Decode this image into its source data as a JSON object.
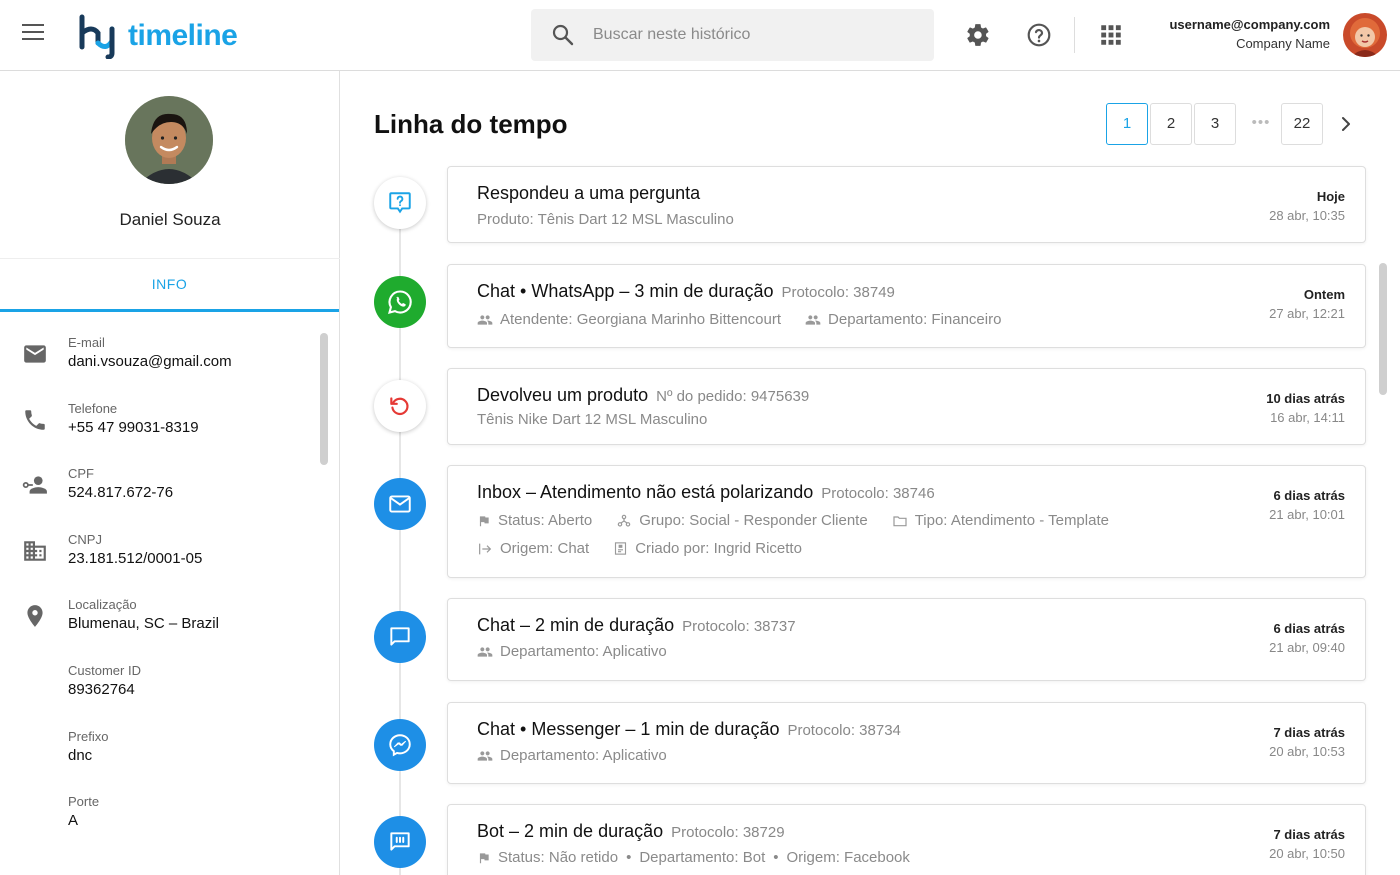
{
  "app": {
    "logo_text": "timeline"
  },
  "search": {
    "placeholder": "Buscar neste histórico"
  },
  "user": {
    "email": "username@company.com",
    "company": "Company Name"
  },
  "profile": {
    "name": "Daniel Souza",
    "tab_info": "INFO",
    "fields": [
      {
        "label": "E-mail",
        "value": "dani.vsouza@gmail.com",
        "icon": "email-icon"
      },
      {
        "label": "Telefone",
        "value": "+55 47 99031-8319",
        "icon": "phone-icon"
      },
      {
        "label": "CPF",
        "value": "524.817.672-76",
        "icon": "person-key-icon"
      },
      {
        "label": "CNPJ",
        "value": "23.181.512/0001-05",
        "icon": "building-icon"
      },
      {
        "label": "Localização",
        "value": "Blumenau, SC – Brazil",
        "icon": "location-icon"
      },
      {
        "label": "Customer ID",
        "value": "89362764"
      },
      {
        "label": "Prefixo",
        "value": "dnc"
      },
      {
        "label": "Porte",
        "value": "A"
      }
    ]
  },
  "main": {
    "title": "Linha do tempo",
    "pagination": {
      "pages": [
        "1",
        "2",
        "3"
      ],
      "last": "22",
      "current": "1"
    },
    "events": [
      {
        "title": "Respondeu a uma pergunta",
        "subtitle": "Produto: Tênis Dart 12 MSL Masculino",
        "when_relative": "Hoje",
        "when_absolute": "28 abr, 10:35",
        "icon": "question-chat-icon"
      },
      {
        "title": "Chat  •  WhatsApp – 3 min de duração",
        "protocol": "Protocolo: 38749",
        "meta": [
          "Atendente: Georgiana Marinho Bittencourt",
          "Departamento: Financeiro"
        ],
        "when_relative": "Ontem",
        "when_absolute": "27 abr, 12:21",
        "icon": "whatsapp-icon"
      },
      {
        "title": "Devolveu um produto",
        "protocol": "Nº do pedido: 9475639",
        "subtitle": "Tênis Nike Dart 12 MSL Masculino",
        "when_relative": "10 dias atrás",
        "when_absolute": "16 abr, 14:11",
        "icon": "return-icon"
      },
      {
        "title": "Inbox – Atendimento não está polarizando",
        "protocol": "Protocolo: 38746",
        "meta": [
          "Status: Aberto",
          "Grupo:  Social - Responder Cliente",
          "Tipo:  Atendimento - Template"
        ],
        "meta2": [
          "Origem: Chat",
          "Criado por: Ingrid Ricetto"
        ],
        "when_relative": "6 dias atrás",
        "when_absolute": "21 abr, 10:01",
        "icon": "mail-icon"
      },
      {
        "title": "Chat – 2 min de duração",
        "protocol": "Protocolo: 38737",
        "meta": [
          "Departamento: Aplicativo"
        ],
        "when_relative": "6 dias atrás",
        "when_absolute": "21 abr, 09:40",
        "icon": "chat-icon"
      },
      {
        "title": "Chat  •  Messenger – 1 min de duração",
        "protocol": "Protocolo: 38734",
        "meta": [
          "Departamento: Aplicativo"
        ],
        "when_relative": "7 dias atrás",
        "when_absolute": "20 abr, 10:53",
        "icon": "messenger-icon"
      },
      {
        "title": "Bot – 2 min de duração",
        "protocol": "Protocolo: 38729",
        "meta": [
          "Status: Não retido",
          "Departamento: Bot",
          "Origem: Facebook"
        ],
        "when_relative": "7 dias atrás",
        "when_absolute": "20 abr, 10:50",
        "icon": "bot-icon"
      }
    ]
  },
  "colors": {
    "accent": "#1aa3e6",
    "whatsapp": "#1fab2e",
    "blue": "#1e8fe6",
    "return_red": "#e53935"
  }
}
